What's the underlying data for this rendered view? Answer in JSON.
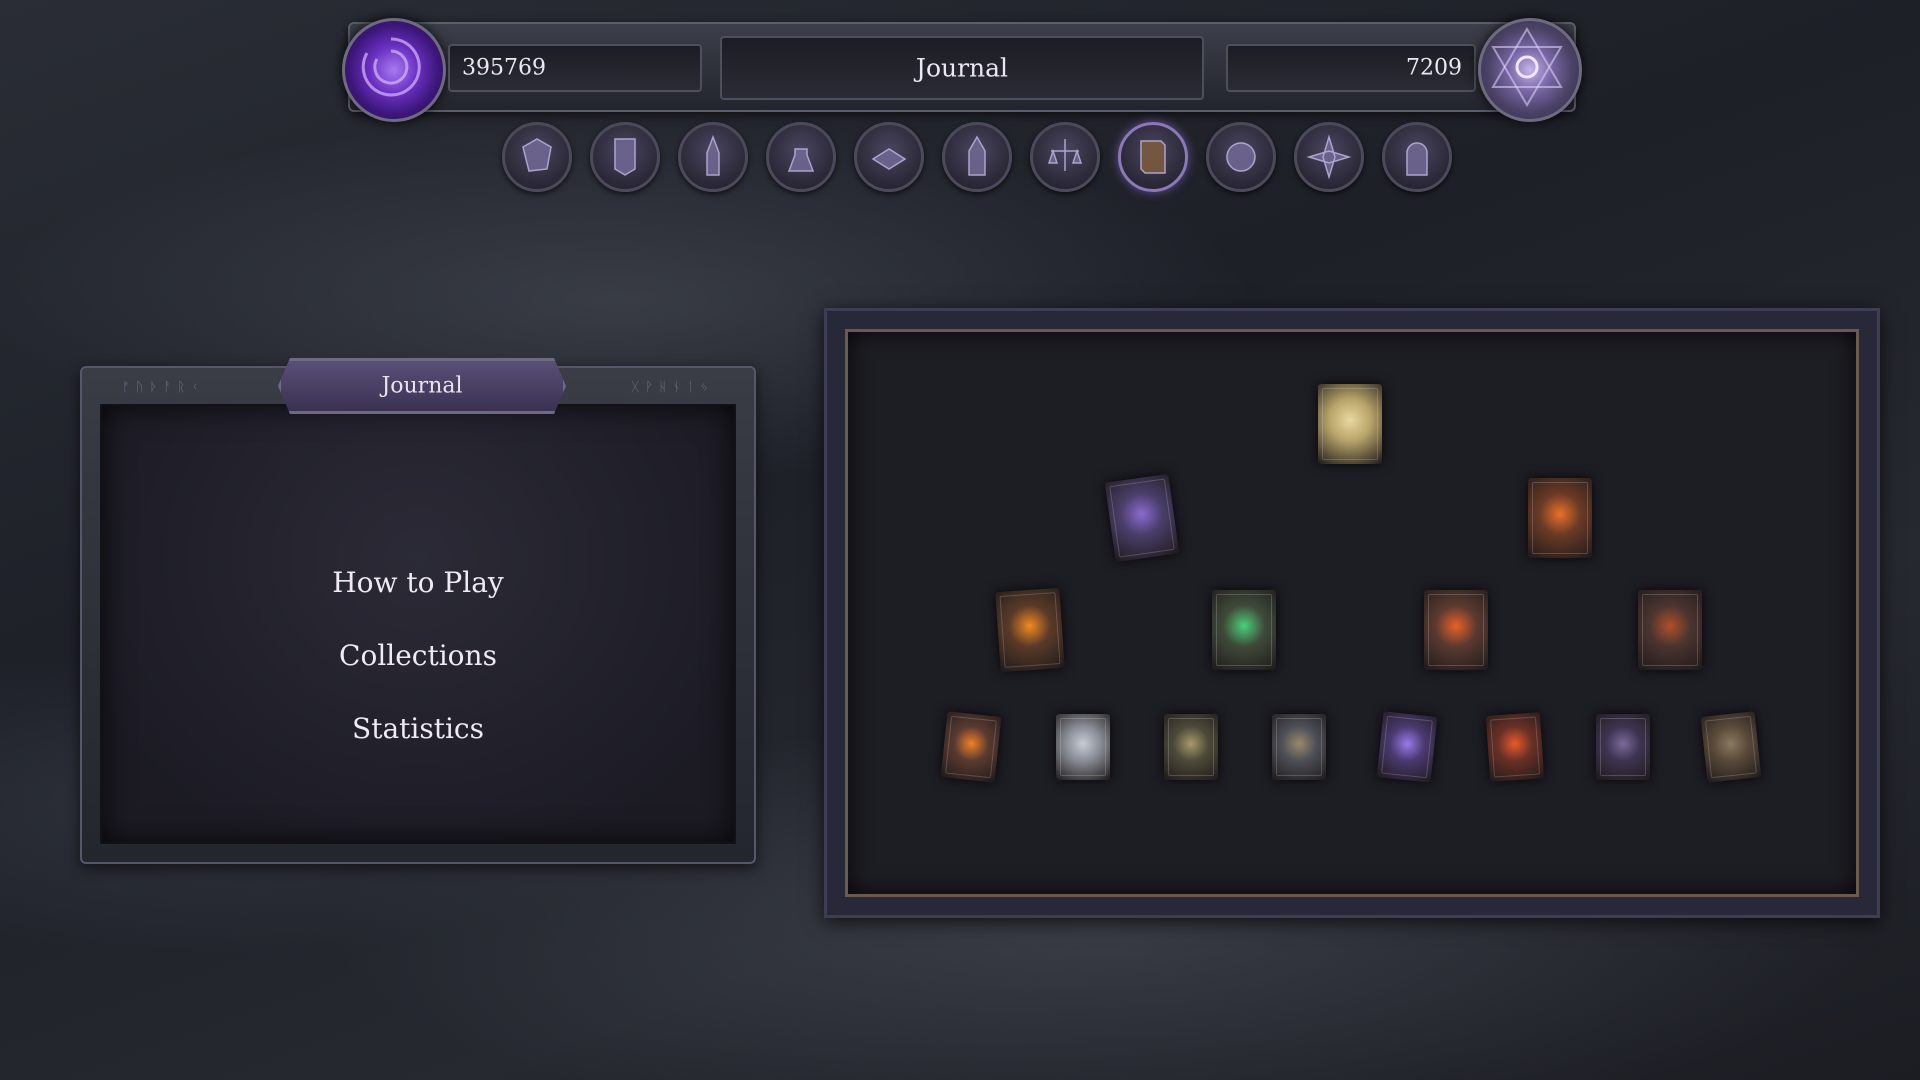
{
  "topbar": {
    "currency_primary": "395769",
    "currency_secondary": "7209",
    "title": "Journal"
  },
  "nav_icons": [
    {
      "name": "world-map-icon",
      "active": false
    },
    {
      "name": "guild-banner-icon",
      "active": false
    },
    {
      "name": "dark-tower-icon",
      "active": false
    },
    {
      "name": "alchemy-potion-icon",
      "active": false
    },
    {
      "name": "crafting-table-icon",
      "active": false
    },
    {
      "name": "castle-spires-icon",
      "active": false
    },
    {
      "name": "trade-scales-icon",
      "active": false
    },
    {
      "name": "journal-book-icon",
      "active": true
    },
    {
      "name": "settings-gear-icon",
      "active": false
    },
    {
      "name": "star-compass-icon",
      "active": false
    },
    {
      "name": "dungeon-door-icon",
      "active": false
    }
  ],
  "left_panel": {
    "tab_title": "Journal",
    "menu": [
      "How to Play",
      "Collections",
      "Statistics"
    ]
  },
  "colors": {
    "accent_purple": "#7a4fd0",
    "panel_border": "#55586a",
    "frame_bronze": "#6b5a4c"
  },
  "collection_books": [
    {
      "name": "golden-tome",
      "color": "#b8a56a",
      "glow": "#e8d9a0"
    },
    {
      "name": "purple-star-tome",
      "color": "#4a3f6a",
      "glow": "#8a6ad0"
    },
    {
      "name": "fire-ember-tome",
      "color": "#6a3a26",
      "glow": "#e8702a"
    },
    {
      "name": "eclipse-tome",
      "color": "#5a3a28",
      "glow": "#f08a20"
    },
    {
      "name": "nature-rune-tome",
      "color": "#3f4a3a",
      "glow": "#4ad07a"
    },
    {
      "name": "flame-rune-tome",
      "color": "#5a3a30",
      "glow": "#e8602a"
    },
    {
      "name": "dim-flame-tome",
      "color": "#4a3430",
      "glow": "#b0502a"
    },
    {
      "name": "small-eclipse-tome",
      "color": "#5a3a30",
      "glow": "#f0802a"
    },
    {
      "name": "silver-orb-tome",
      "color": "#8a8e96",
      "glow": "#c8ccd4"
    },
    {
      "name": "bronze-sigil-tome",
      "color": "#4e4a3a",
      "glow": "#a89a6a"
    },
    {
      "name": "steel-emblem-tome",
      "color": "#4e5058",
      "glow": "#9a8a6a"
    },
    {
      "name": "violet-bolt-tome",
      "color": "#4a3a70",
      "glow": "#9a7ae8"
    },
    {
      "name": "crimson-flare-tome",
      "color": "#6a3026",
      "glow": "#e85a2a"
    },
    {
      "name": "shadow-flame-tome",
      "color": "#3e3450",
      "glow": "#7a6a9a"
    },
    {
      "name": "worn-leather-tome",
      "color": "#5a4a3a",
      "glow": "#8a7a60"
    }
  ]
}
